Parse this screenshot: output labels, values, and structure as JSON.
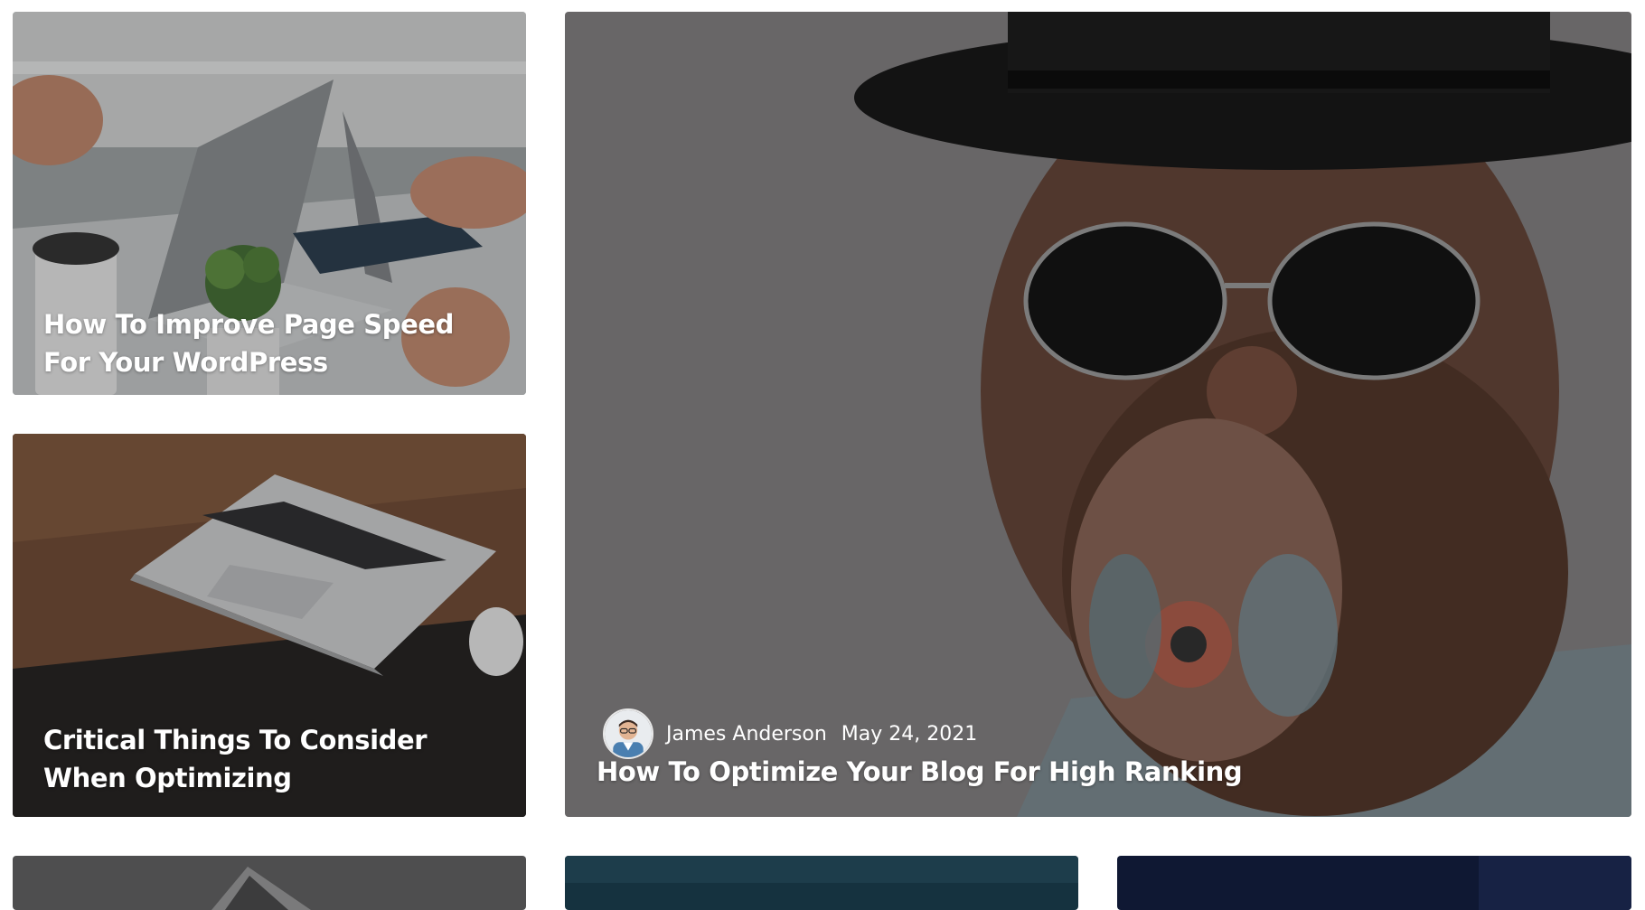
{
  "cards": {
    "card1": {
      "title": "How To Improve Page Speed For Your WordPress",
      "image": "laptops-on-desk-image"
    },
    "card2": {
      "title": "Critical Things To Consider When Optimizing",
      "image": "laptop-on-wooden-desk-image"
    },
    "featured": {
      "title": "How To Optimize Your Blog For High Ranking",
      "author": "James Anderson",
      "date": "May 24, 2021",
      "image": "bearded-man-hat-sunglasses-image",
      "avatar": "author-avatar"
    }
  },
  "colors": {
    "featured_bg": "#747273",
    "title_text": "#ffffff"
  }
}
